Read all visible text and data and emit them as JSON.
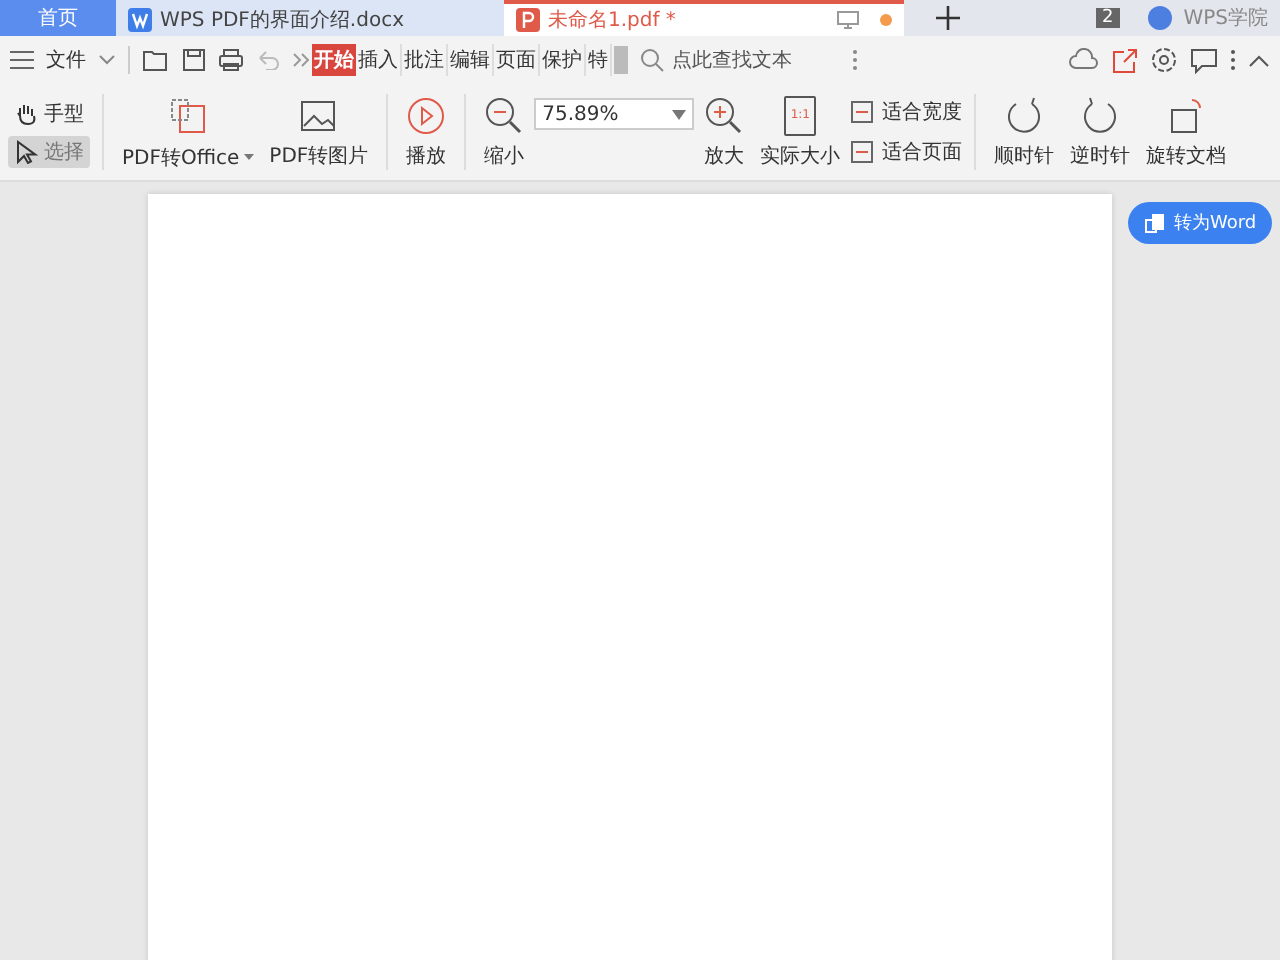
{
  "tabs": [
    {
      "label": "首页",
      "kind": "home",
      "selected": false
    },
    {
      "label": "WPS PDF的界面介绍.docx",
      "kind": "doc",
      "selected": false
    },
    {
      "label": "未命名1.pdf *",
      "kind": "pdf",
      "selected": true
    }
  ],
  "tab_count": "2",
  "account": "WPS学院",
  "menu": {
    "file": "文件",
    "ribbon_tabs": [
      {
        "label": "开始",
        "selected": true
      },
      {
        "label": "插入",
        "selected": false
      },
      {
        "label": "批注",
        "selected": false
      },
      {
        "label": "编辑",
        "selected": false
      },
      {
        "label": "页面",
        "selected": false
      },
      {
        "label": "保护",
        "selected": false
      },
      {
        "label": "特",
        "selected": false
      }
    ],
    "search": {
      "placeholder": "点此查找文本"
    }
  },
  "modes": [
    {
      "label": "手型",
      "kind": "hand",
      "selected": false
    },
    {
      "label": "选择",
      "kind": "select",
      "selected": true
    }
  ],
  "tools": [
    {
      "label": "PDF转Office",
      "kind": "office"
    },
    {
      "label": "PDF转图片",
      "kind": "image"
    },
    {
      "label": "播放",
      "kind": "play"
    },
    {
      "label": "缩小",
      "kind": "zoomout"
    }
  ],
  "zoom": {
    "value": "75.89%"
  },
  "tools2": [
    {
      "label": "放大",
      "kind": "zoomin"
    },
    {
      "label": "实际大小",
      "kind": "actual",
      "glyph": "1:1"
    }
  ],
  "fit": [
    {
      "label": "适合宽度"
    },
    {
      "label": "适合页面"
    }
  ],
  "tools3": [
    {
      "label": "顺时针",
      "kind": "cw"
    },
    {
      "label": "逆时针",
      "kind": "ccw"
    },
    {
      "label": "旋转文档",
      "kind": "rotate"
    }
  ],
  "convert_button": "转为Word"
}
